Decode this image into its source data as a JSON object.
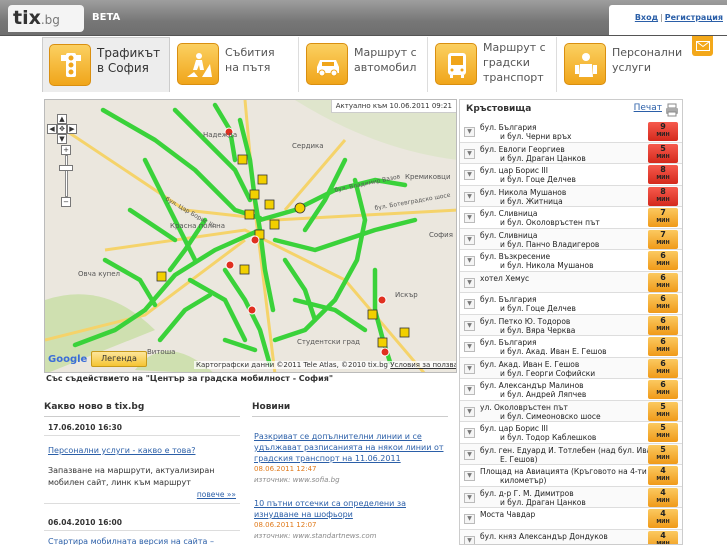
{
  "header": {
    "logo_main": "tix",
    "logo_dot": ".bg",
    "beta": "BETA",
    "login": "Вход",
    "sep": "|",
    "register": "Регистрация",
    "mail_icon": "envelope-icon"
  },
  "nav": [
    {
      "line1": "Трафикът",
      "line2": "в София",
      "icon": "traffic-light-icon"
    },
    {
      "line1": "Събития",
      "line2": "на пътя",
      "icon": "roadwork-icon"
    },
    {
      "line1": "Маршрут с",
      "line2": "автомобил",
      "icon": "car-icon"
    },
    {
      "line1": "Маршрут с",
      "line2": "градски",
      "line3": "транспорт",
      "icon": "bus-icon"
    },
    {
      "line1": "Персонални",
      "line2": "услуги",
      "icon": "person-icon"
    }
  ],
  "map": {
    "updated": "Актуално към 10.06.2011 09:21",
    "legend": "Легенда",
    "google": "Google",
    "copyright": "Картографски данни ©2011 Tele Atlas, ©2010 tix.bg",
    "terms": "Условия за ползване",
    "credit": "Със съдействието на \"Център за градска мобилност - София\"",
    "labels": [
      "Надежда",
      "Сердика",
      "Кремиковци",
      "бул. Владимир Вазов",
      "бул. Ботевградско шосе",
      "София",
      "Красна поляна",
      "Овча купел",
      "Витоша",
      "Студентски град",
      "Искър",
      "бул. Цар Борис III"
    ]
  },
  "crossroads": {
    "title": "Кръстовища",
    "print": "Печат",
    "unit": "МИН",
    "rows": [
      {
        "l1": "бул. България",
        "l2": "и бул. Черни връх",
        "score": "9",
        "color": "red"
      },
      {
        "l1": "бул. Евлоги Георгиев",
        "l2": "и бул. Драган Цанков",
        "score": "5",
        "color": "red"
      },
      {
        "l1": "бул. цар Борис III",
        "l2": "и бул. Гоце Делчев",
        "score": "8",
        "color": "red"
      },
      {
        "l1": "бул. Никола Мушанов",
        "l2": "и бул. Житница",
        "score": "8",
        "color": "red"
      },
      {
        "l1": "бул. Сливница",
        "l2": "и бул. Околовръстен път",
        "score": "7",
        "color": "orange"
      },
      {
        "l1": "бул. Сливница",
        "l2": "и бул. Панчо Владигеров",
        "score": "7",
        "color": "orange"
      },
      {
        "l1": "бул. Възкресение",
        "l2": "и бул. Никола Мушанов",
        "score": "6",
        "color": "orange"
      },
      {
        "l1": "хотел Хемус",
        "l2": "",
        "score": "6",
        "color": "orange"
      },
      {
        "l1": "бул. България",
        "l2": "и бул. Гоце Делчев",
        "score": "6",
        "color": "orange"
      },
      {
        "l1": "бул. Петко Ю. Тодоров",
        "l2": "и бул. Вяра Черква",
        "score": "6",
        "color": "orange"
      },
      {
        "l1": "бул. България",
        "l2": "и бул. Акад. Иван Е. Гешов",
        "score": "6",
        "color": "orange"
      },
      {
        "l1": "бул. Акад. Иван Е. Гешов",
        "l2": "и бул. Георги Софийски",
        "score": "6",
        "color": "orange"
      },
      {
        "l1": "бул. Александър Малинов",
        "l2": "и бул. Андрей Ляпчев",
        "score": "6",
        "color": "orange"
      },
      {
        "l1": "ул. Околовръстен път",
        "l2": "и бул. Симеоновско шосе",
        "score": "5",
        "color": "orange"
      },
      {
        "l1": "бул. цар Борис III",
        "l2": "и бул. Тодор Каблешков",
        "score": "5",
        "color": "orange"
      },
      {
        "l1": "бул. ген. Едуард И. Тотлебен (над бул. Иван",
        "l2": "Е. Гешов)",
        "score": "5",
        "color": "orange"
      },
      {
        "l1": "Площад на Авиацията (Кръговото на 4-ти",
        "l2": "километър)",
        "score": "4",
        "color": "orange"
      },
      {
        "l1": "бул. д-р Г. М. Димитров",
        "l2": "и бул. Драган Цанков",
        "score": "4",
        "color": "orange"
      },
      {
        "l1": "Моста Чавдар",
        "l2": "",
        "score": "4",
        "color": "orange"
      },
      {
        "l1": "бул. княз Александър Дондуков",
        "l2": "",
        "score": "4",
        "color": "orange"
      }
    ]
  },
  "whatsnew": {
    "title": "Какво ново в tix.bg",
    "items": [
      {
        "date": "17.06.2010 16:30",
        "link": "Персонални услуги - какво е това?",
        "text": "Запазване на маршрути, актуализиран мобилен сайт, линк към маршрут",
        "more": "повече »»"
      },
      {
        "date": "06.04.2010 16:00",
        "link": "Стартира мобилната версия на сайта – http://m.tix.bg."
      }
    ]
  },
  "news": {
    "title": "Новини",
    "items": [
      {
        "link": "Разкриват се допълнителни линии и се удължават разписанията на някои линии от градския транспорт на 11.06.2011",
        "date": "08.06.2011 12:47",
        "source": "източник: www.sofia.bg"
      },
      {
        "link": "10 пътни отсечки са определени за изнудване на шофьори",
        "date": "08.06.2011 12:07",
        "source": "източник: www.standartnews.com"
      }
    ]
  }
}
